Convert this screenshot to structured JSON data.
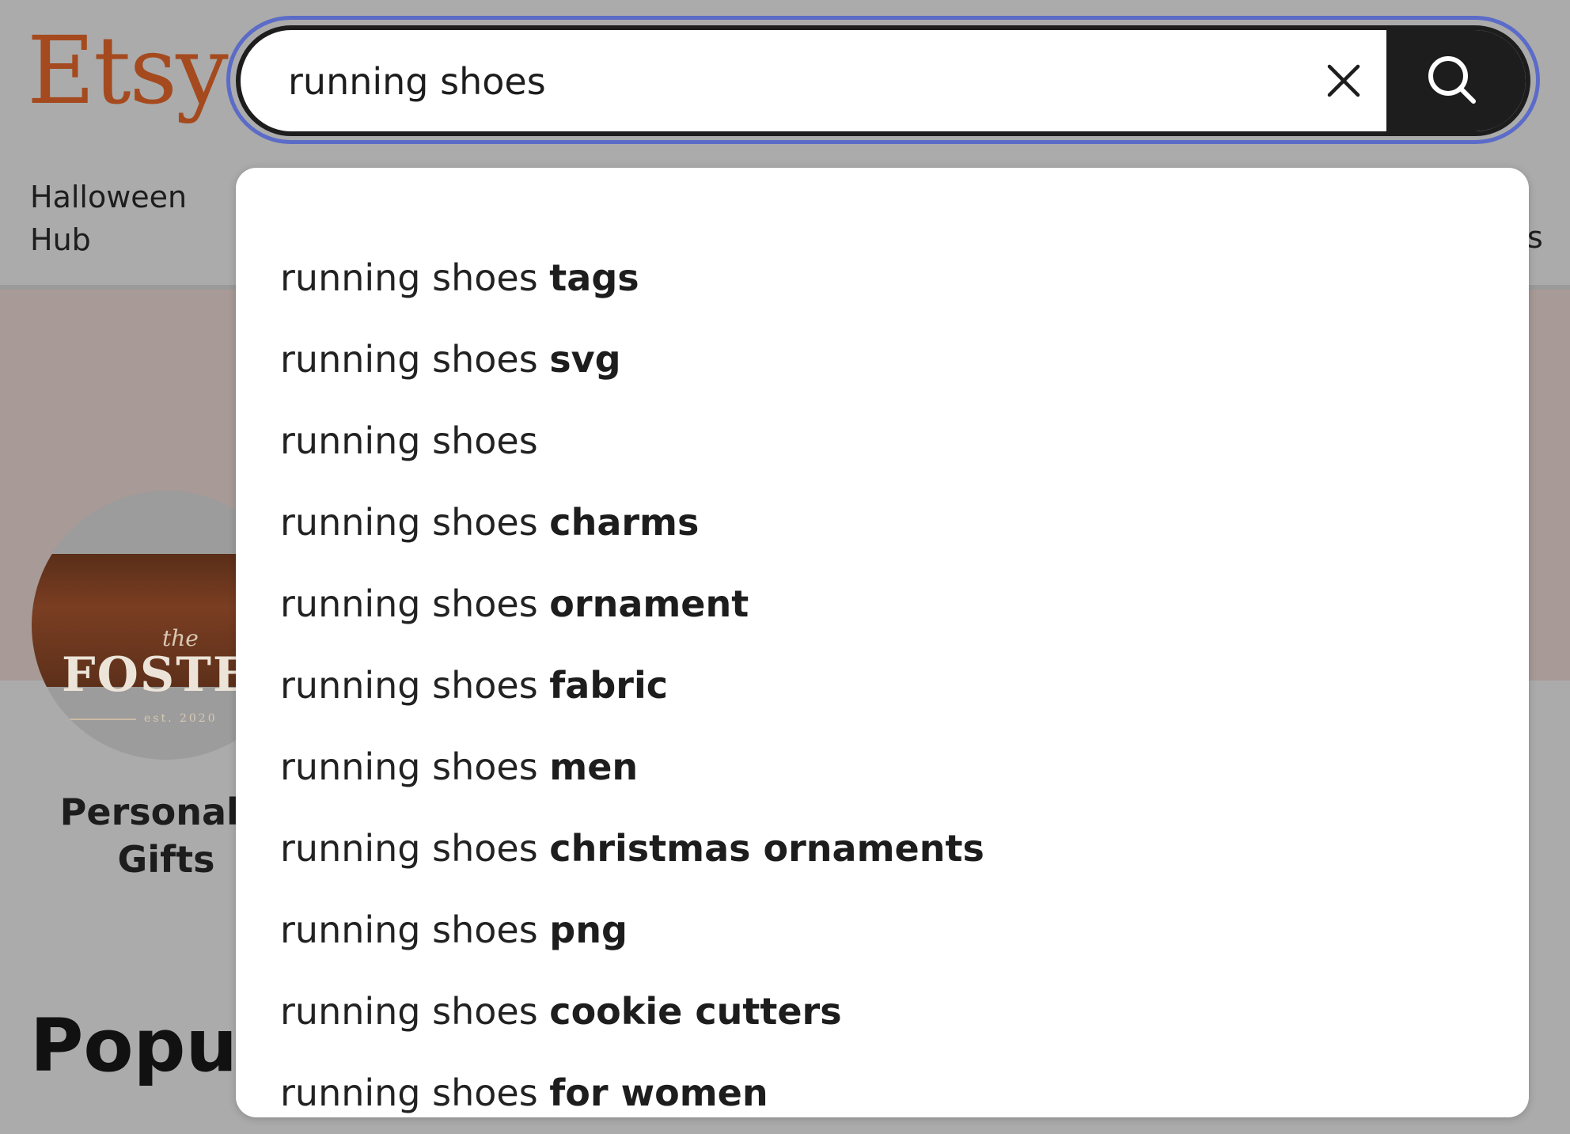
{
  "logo": {
    "text": "Etsy",
    "color": "#a54a1e"
  },
  "nav": {
    "halloween_hub": "Halloween Hub",
    "edge_fragment": "s"
  },
  "search": {
    "value": "running shoes",
    "clear_icon": "close-icon",
    "submit_icon": "search-icon",
    "focus_ring_color": "#5b6bc8"
  },
  "suggestions": [
    {
      "base": "running shoes",
      "completion": "tags"
    },
    {
      "base": "running shoes",
      "completion": "svg"
    },
    {
      "base": "running shoes",
      "completion": ""
    },
    {
      "base": "running shoes",
      "completion": "charms"
    },
    {
      "base": "running shoes",
      "completion": "ornament"
    },
    {
      "base": "running shoes",
      "completion": "fabric"
    },
    {
      "base": "running shoes",
      "completion": "men"
    },
    {
      "base": "running shoes",
      "completion": "christmas ornaments"
    },
    {
      "base": "running shoes",
      "completion": "png"
    },
    {
      "base": "running shoes",
      "completion": "cookie cutters"
    },
    {
      "base": "running shoes",
      "completion": "for women"
    }
  ],
  "category": {
    "label": "Personaliz Gifts",
    "image": {
      "small": "the",
      "big": "FOSTE",
      "est": "est. 2020"
    }
  },
  "section": {
    "heading": "Popula"
  }
}
